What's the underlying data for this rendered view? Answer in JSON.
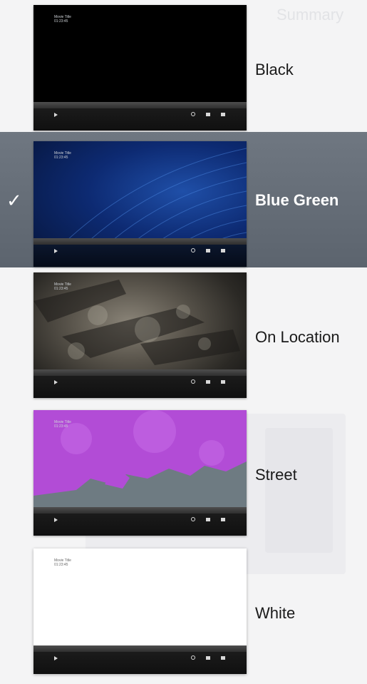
{
  "themes": [
    {
      "label": "Black",
      "selected": false,
      "video_title": "Movie Title",
      "video_time": "01:23:45"
    },
    {
      "label": "Blue Green",
      "selected": true,
      "video_title": "Movie Title",
      "video_time": "01:23:45"
    },
    {
      "label": "On Location",
      "selected": false,
      "video_title": "Movie Title",
      "video_time": "01:23:45"
    },
    {
      "label": "Street",
      "selected": false,
      "video_title": "Movie Title",
      "video_time": "01:23:45"
    },
    {
      "label": "White",
      "selected": false,
      "video_title": "Movie Title",
      "video_time": "01:23:45"
    }
  ],
  "selected_check": "✓",
  "background_text": "Summary",
  "icons": {
    "check": "checkmark-icon",
    "play": "play-icon",
    "preview": "eye-icon",
    "menu": "menu-icon",
    "fullscreen": "fullscreen-icon"
  }
}
